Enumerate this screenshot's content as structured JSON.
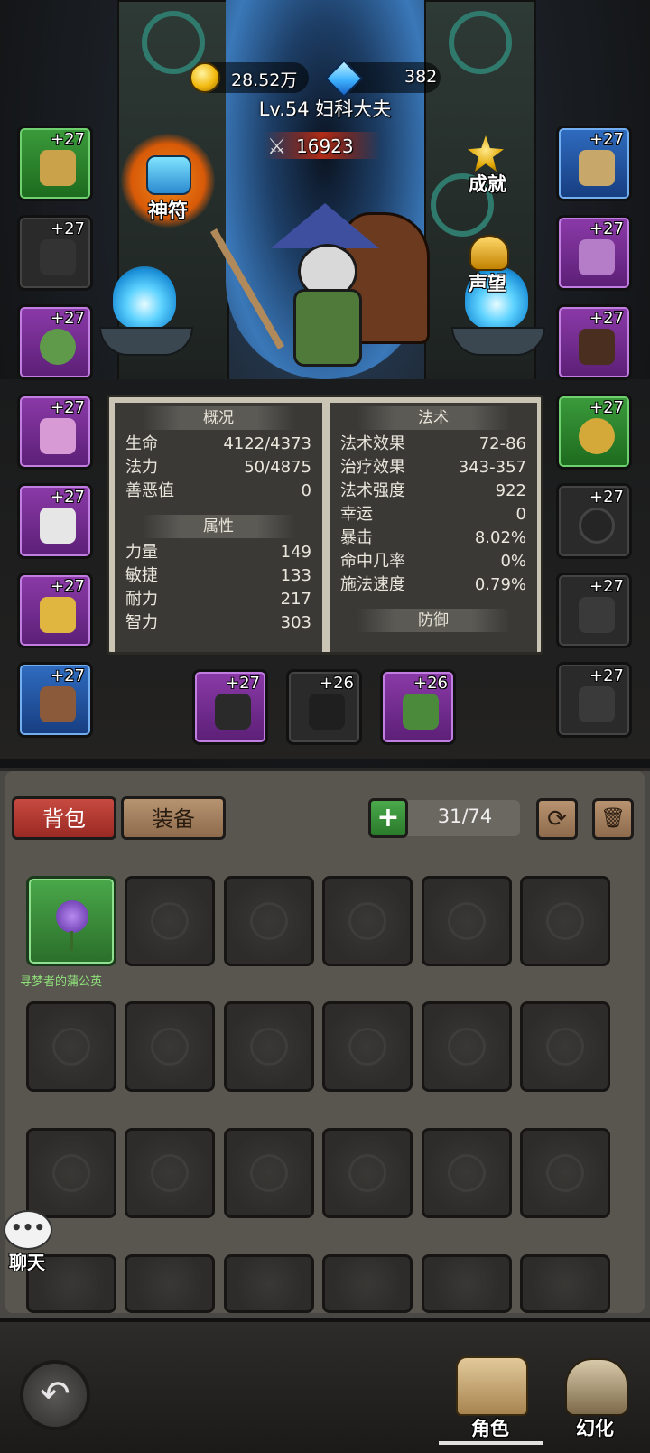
{
  "currency": {
    "gold": "28.52万",
    "gems": "382"
  },
  "player": {
    "level_name": "Lv.54 妇科大夫",
    "power": "16923"
  },
  "buttons": {
    "rune": "神符",
    "achievement": "成就",
    "reputation": "声望"
  },
  "left_slots": [
    "+27",
    "+27",
    "+27",
    "+27",
    "+27",
    "+27",
    "+27"
  ],
  "right_slots": [
    "+27",
    "+27",
    "+27",
    "+27",
    "+27",
    "+27",
    "+27"
  ],
  "weapon_slots": [
    "+27",
    "+26",
    "+26"
  ],
  "stats": {
    "overview_title": "概况",
    "overview": [
      [
        "生命",
        "4122/4373"
      ],
      [
        "法力",
        "50/4875"
      ],
      [
        "善恶值",
        "0"
      ]
    ],
    "attr_title": "属性",
    "attributes": [
      [
        "力量",
        "149"
      ],
      [
        "敏捷",
        "133"
      ],
      [
        "耐力",
        "217"
      ],
      [
        "智力",
        "303"
      ]
    ],
    "spell_title": "法术",
    "spells": [
      [
        "法术效果",
        "72-86"
      ],
      [
        "治疗效果",
        "343-357"
      ],
      [
        "法术强度",
        "922"
      ],
      [
        "幸运",
        "0"
      ],
      [
        "暴击",
        "8.02%"
      ],
      [
        "命中几率",
        "0%"
      ],
      [
        "施法速度",
        "0.79%"
      ]
    ],
    "defense_title": "防御"
  },
  "bag": {
    "tab_bag": "背包",
    "tab_equip": "装备",
    "add": "+",
    "capacity": "31/74",
    "item_name": "寻梦者的蒲公英"
  },
  "chat": {
    "label": "聊天",
    "icon": "•••"
  },
  "nav": {
    "role": "角色",
    "transform": "幻化"
  },
  "colors": {
    "gold": "#f2b90f",
    "green_quality": "#3b9b3b",
    "purple_quality": "#8b3aa8",
    "blue_quality": "#2f6cc0",
    "tab_red": "#b5352f"
  }
}
